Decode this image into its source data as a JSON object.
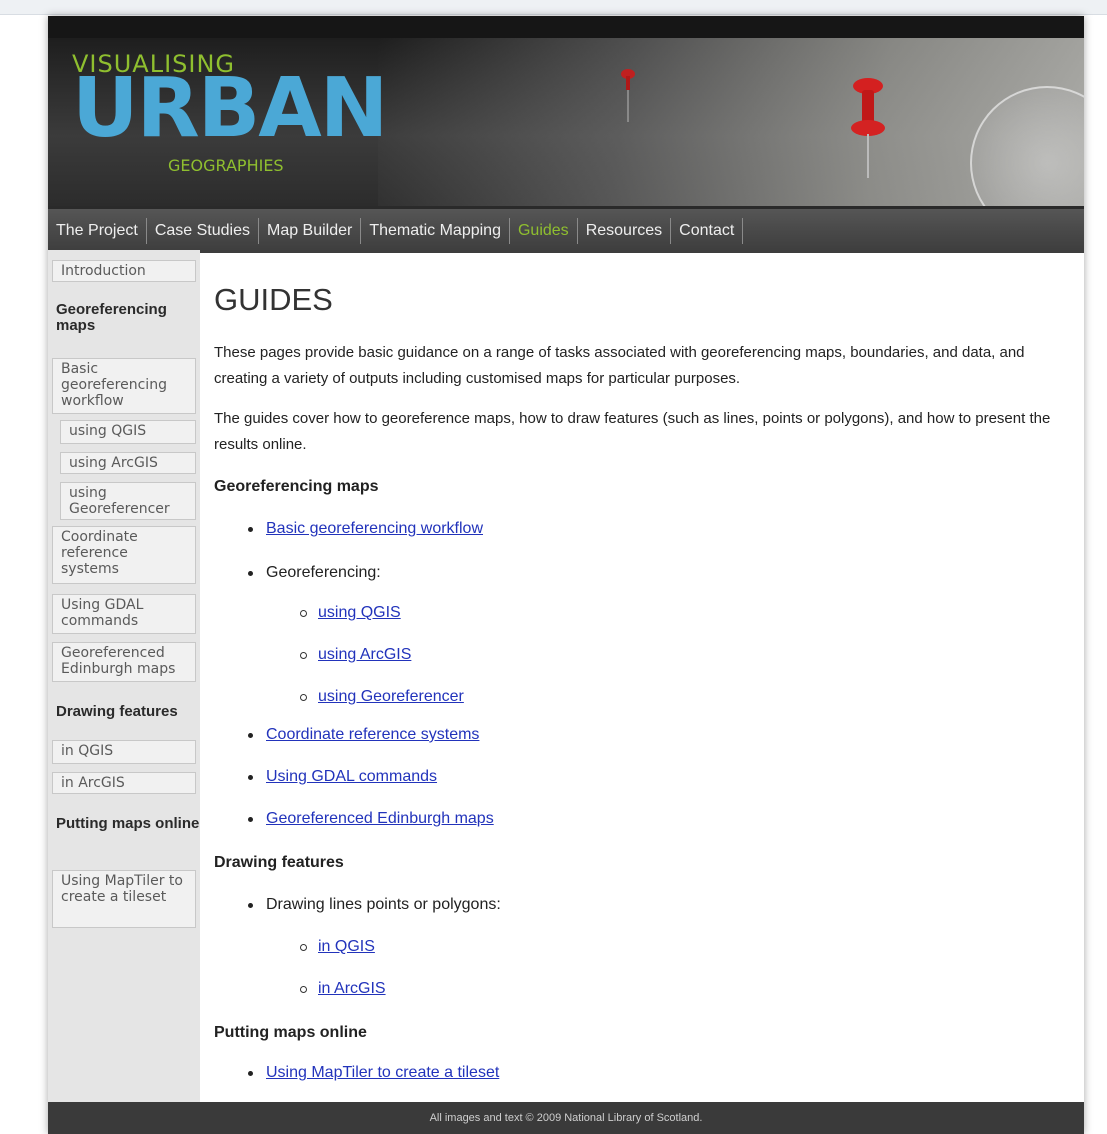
{
  "logo": {
    "line1": "VISUALISING",
    "line2": "URBAN",
    "line3": "GEOGRAPHIES"
  },
  "nav": {
    "items": [
      {
        "label": "The Project"
      },
      {
        "label": "Case Studies"
      },
      {
        "label": "Map Builder"
      },
      {
        "label": "Thematic Mapping"
      },
      {
        "label": "Guides",
        "active": true
      },
      {
        "label": "Resources"
      },
      {
        "label": "Contact"
      }
    ]
  },
  "sidebar": {
    "introduction": "Introduction",
    "section1": "Georeferencing maps",
    "basic": "Basic georeferencing workflow",
    "qgis": "using QGIS",
    "arcgis": "using ArcGIS",
    "georeferencer": "using Georeferencer",
    "crs": "Coordinate reference systems",
    "gdal": "Using GDAL commands",
    "edinburgh": "Georeferenced Edinburgh maps",
    "section2": "Drawing features",
    "in_qgis": "in QGIS",
    "in_arcgis": "in ArcGIS",
    "section3": "Putting maps online",
    "maptiler": "Using MapTiler to create a tileset"
  },
  "content": {
    "title": "GUIDES",
    "para1": "These pages provide basic guidance on a range of tasks associated with georeferencing maps, boundaries, and data, and creating a variety of outputs including customised maps for particular purposes.",
    "para2": "The guides cover how to georeference maps, how to draw features (such as lines, points or polygons), and how to present the results online.",
    "h_georef": "Georeferencing maps",
    "link_basic": "Basic georeferencing workflow",
    "georef_label": "Georeferencing:",
    "link_qgis": "using QGIS",
    "link_arcgis": "using ArcGIS",
    "link_georeferencer": "using Georeferencer",
    "link_crs": "Coordinate reference systems",
    "link_gdal": "Using GDAL commands",
    "link_edinburgh": "Georeferenced Edinburgh maps",
    "h_drawing": "Drawing features",
    "drawing_label": "Drawing lines points or polygons:",
    "link_in_qgis": "in QGIS",
    "link_in_arcgis": "in ArcGIS",
    "h_online": "Putting maps online",
    "link_maptiler": "Using MapTiler to create a tileset"
  },
  "footer": {
    "text": "All images and text © 2009 National Library of Scotland."
  },
  "colors": {
    "accent_green": "#8fbf2f",
    "logo_blue": "#4ba8d6",
    "link_blue": "#2233bb"
  }
}
